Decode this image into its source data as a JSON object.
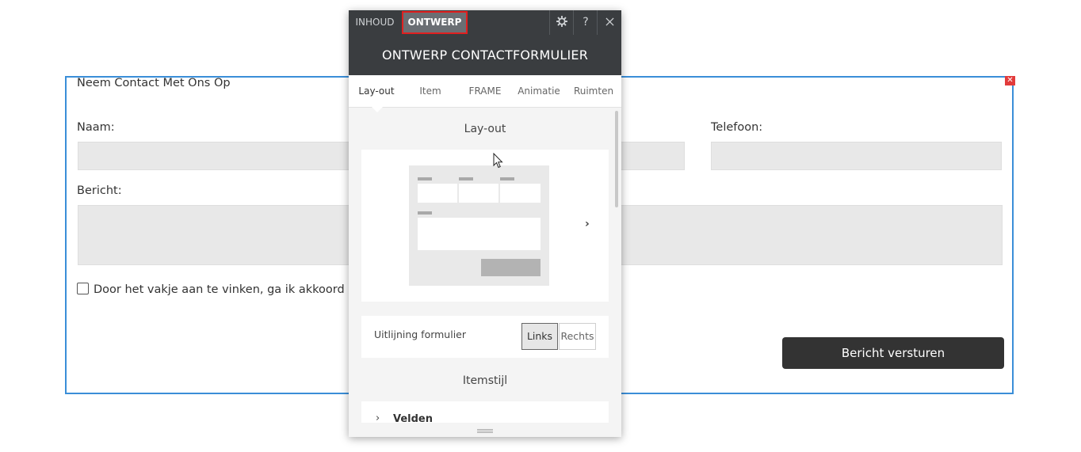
{
  "form": {
    "title": "Neem Contact Met Ons Op",
    "name_label": "Naam:",
    "phone_label": "Telefoon:",
    "message_label": "Bericht:",
    "consent_text": "Door het vakje aan te vinken, ga ik akkoord met h",
    "submit_label": "Bericht versturen",
    "close_icon": "close-icon"
  },
  "panel": {
    "tabs": {
      "inhoud": "INHOUD",
      "ontwerp": "ONTWERP"
    },
    "toolbar": {
      "settings_icon": "gear-icon",
      "help_label": "?",
      "close_icon": "close-icon"
    },
    "title": "ONTWERP CONTACTFORMULIER",
    "subtabs": [
      {
        "label": "Lay-out",
        "active": true
      },
      {
        "label": "Item",
        "active": false
      },
      {
        "label": "FRAME",
        "active": false
      },
      {
        "label": "Animatie",
        "active": false
      },
      {
        "label": "Ruimten",
        "active": false
      }
    ],
    "layout_section_title": "Lay-out",
    "next_layout_icon": "chevron-right-icon",
    "alignment": {
      "label": "Uitlijning formulier",
      "options": [
        "Links",
        "Rechts"
      ],
      "selected": "Links"
    },
    "item_style_title": "Itemstijl",
    "accordion": {
      "label": "Velden",
      "icon": "chevron-right-icon"
    }
  },
  "colors": {
    "selection_border": "#3a8ed8",
    "panel_dark": "#3a3d40",
    "active_tab_outline": "#e02020",
    "submit_button": "#333333"
  }
}
